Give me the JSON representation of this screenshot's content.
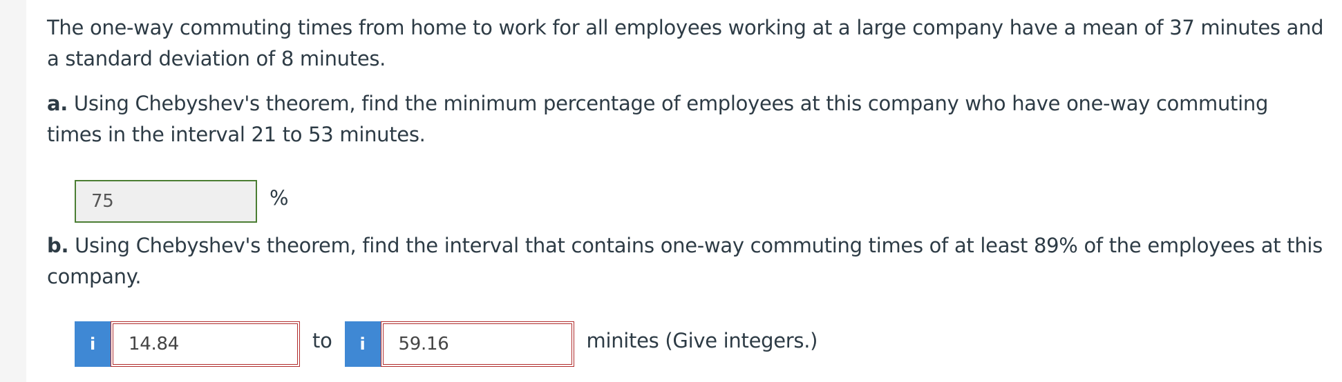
{
  "intro": "The one-way commuting times from home to work for all employees working at a large company have a mean of 37 minutes and a standard deviation of 8 minutes.",
  "part_a": {
    "label": "a.",
    "question": " Using Chebyshev's theorem, find the minimum percentage of employees at this company who have one-way commuting times in the interval 21 to 53 minutes.",
    "answer": "75",
    "unit": "%"
  },
  "part_b": {
    "label": "b.",
    "question": " Using Chebyshev's theorem, find the interval that contains one-way commuting times of at least 89% of the employees at this company.",
    "info_icon": "i",
    "lower": "14.84",
    "connector": "to",
    "upper": "59.16",
    "tail": "minites (Give integers.)"
  },
  "colors": {
    "correct_border": "#4a7d32",
    "incorrect_border": "#b02b2b",
    "info_button": "#3f88d4"
  }
}
